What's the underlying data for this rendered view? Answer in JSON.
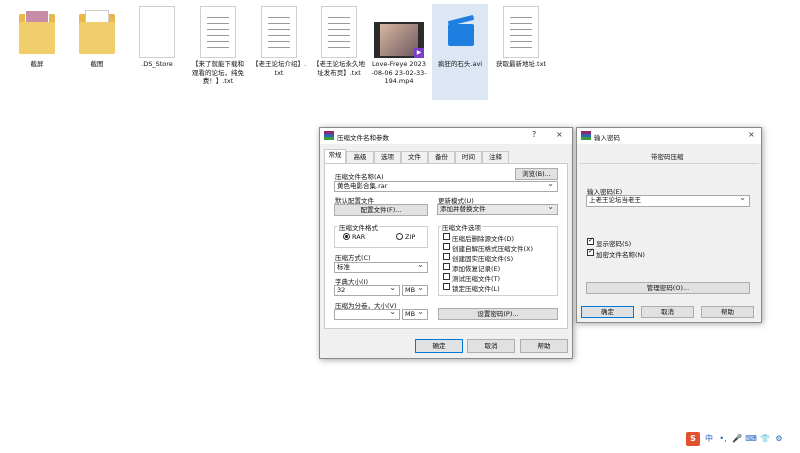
{
  "desktop": {
    "files": [
      {
        "label": "截屏",
        "icon": "folder-icon"
      },
      {
        "label": "截图",
        "icon": "folder-icon"
      },
      {
        "label": ".DS_Store",
        "icon": "blank-file-icon"
      },
      {
        "label": "【来了就能下载和观看的论坛，纯免费！】.txt",
        "icon": "text-file-icon"
      },
      {
        "label": "【老王论坛介绍】.txt",
        "icon": "text-file-icon"
      },
      {
        "label": "【老王论坛永久地址发布页】.txt",
        "icon": "text-file-icon"
      },
      {
        "label": "Love-Freye 2023-08-06 23-02-33-194.mp4",
        "icon": "video-thumbnail-icon"
      },
      {
        "label": "疯狂的石头.avi",
        "icon": "clapperboard-icon"
      },
      {
        "label": "获取最新地址.txt",
        "icon": "text-file-icon"
      }
    ]
  },
  "archive_dialog": {
    "title": "压缩文件名和参数",
    "help": "?",
    "close": "×",
    "tabs": [
      "常规",
      "高级",
      "选项",
      "文件",
      "备份",
      "时间",
      "注释"
    ],
    "archive_name_label": "压缩文件名称(A)",
    "browse_button": "浏览(B)...",
    "archive_name_value": "黄色电影合集.rar",
    "profile_label": "默认配置文件",
    "profile_button": "配置文件(F)...",
    "update_mode_label": "更新模式(U)",
    "update_mode_value": "添加并替换文件",
    "format_label": "压缩文件格式",
    "format_rar": "RAR",
    "format_zip": "ZIP",
    "method_label": "压缩方式(C)",
    "method_value": "标准",
    "dict_label": "字典大小(I)",
    "dict_value": "32",
    "dict_unit": "MB",
    "split_label": "压缩为分卷，大小(V)",
    "split_unit": "MB",
    "options_label": "压缩文件选项",
    "options": [
      {
        "label": "压缩后删除源文件(D)",
        "checked": false
      },
      {
        "label": "创建自解压格式压缩文件(X)",
        "checked": false
      },
      {
        "label": "创建固实压缩文件(S)",
        "checked": false
      },
      {
        "label": "添加恢复记录(E)",
        "checked": false
      },
      {
        "label": "测试压缩文件(T)",
        "checked": false
      },
      {
        "label": "锁定压缩文件(L)",
        "checked": false
      }
    ],
    "set_password_button": "设置密码(P)...",
    "ok_button": "确定",
    "cancel_button": "取消",
    "help_button": "帮助"
  },
  "password_dialog": {
    "title": "输入密码",
    "close": "×",
    "header": "带密码压缩",
    "password_label": "输入密码(E)",
    "password_value": "上老王论坛当老王",
    "show_password": "显示密码(S)",
    "encrypt_names": "加密文件名称(N)",
    "manage_button": "管理密码(O)...",
    "ok_button": "确定",
    "cancel_button": "取消",
    "help_button": "帮助"
  },
  "tray": {
    "ime_logo": "S",
    "ime_lang": "中",
    "items": [
      "•,",
      "🎤",
      "⌨",
      "👕",
      "⚙"
    ]
  },
  "colors": {
    "accent": "#0078d7",
    "ime": "#e2522e",
    "video_icon": "#1e7fe0"
  }
}
